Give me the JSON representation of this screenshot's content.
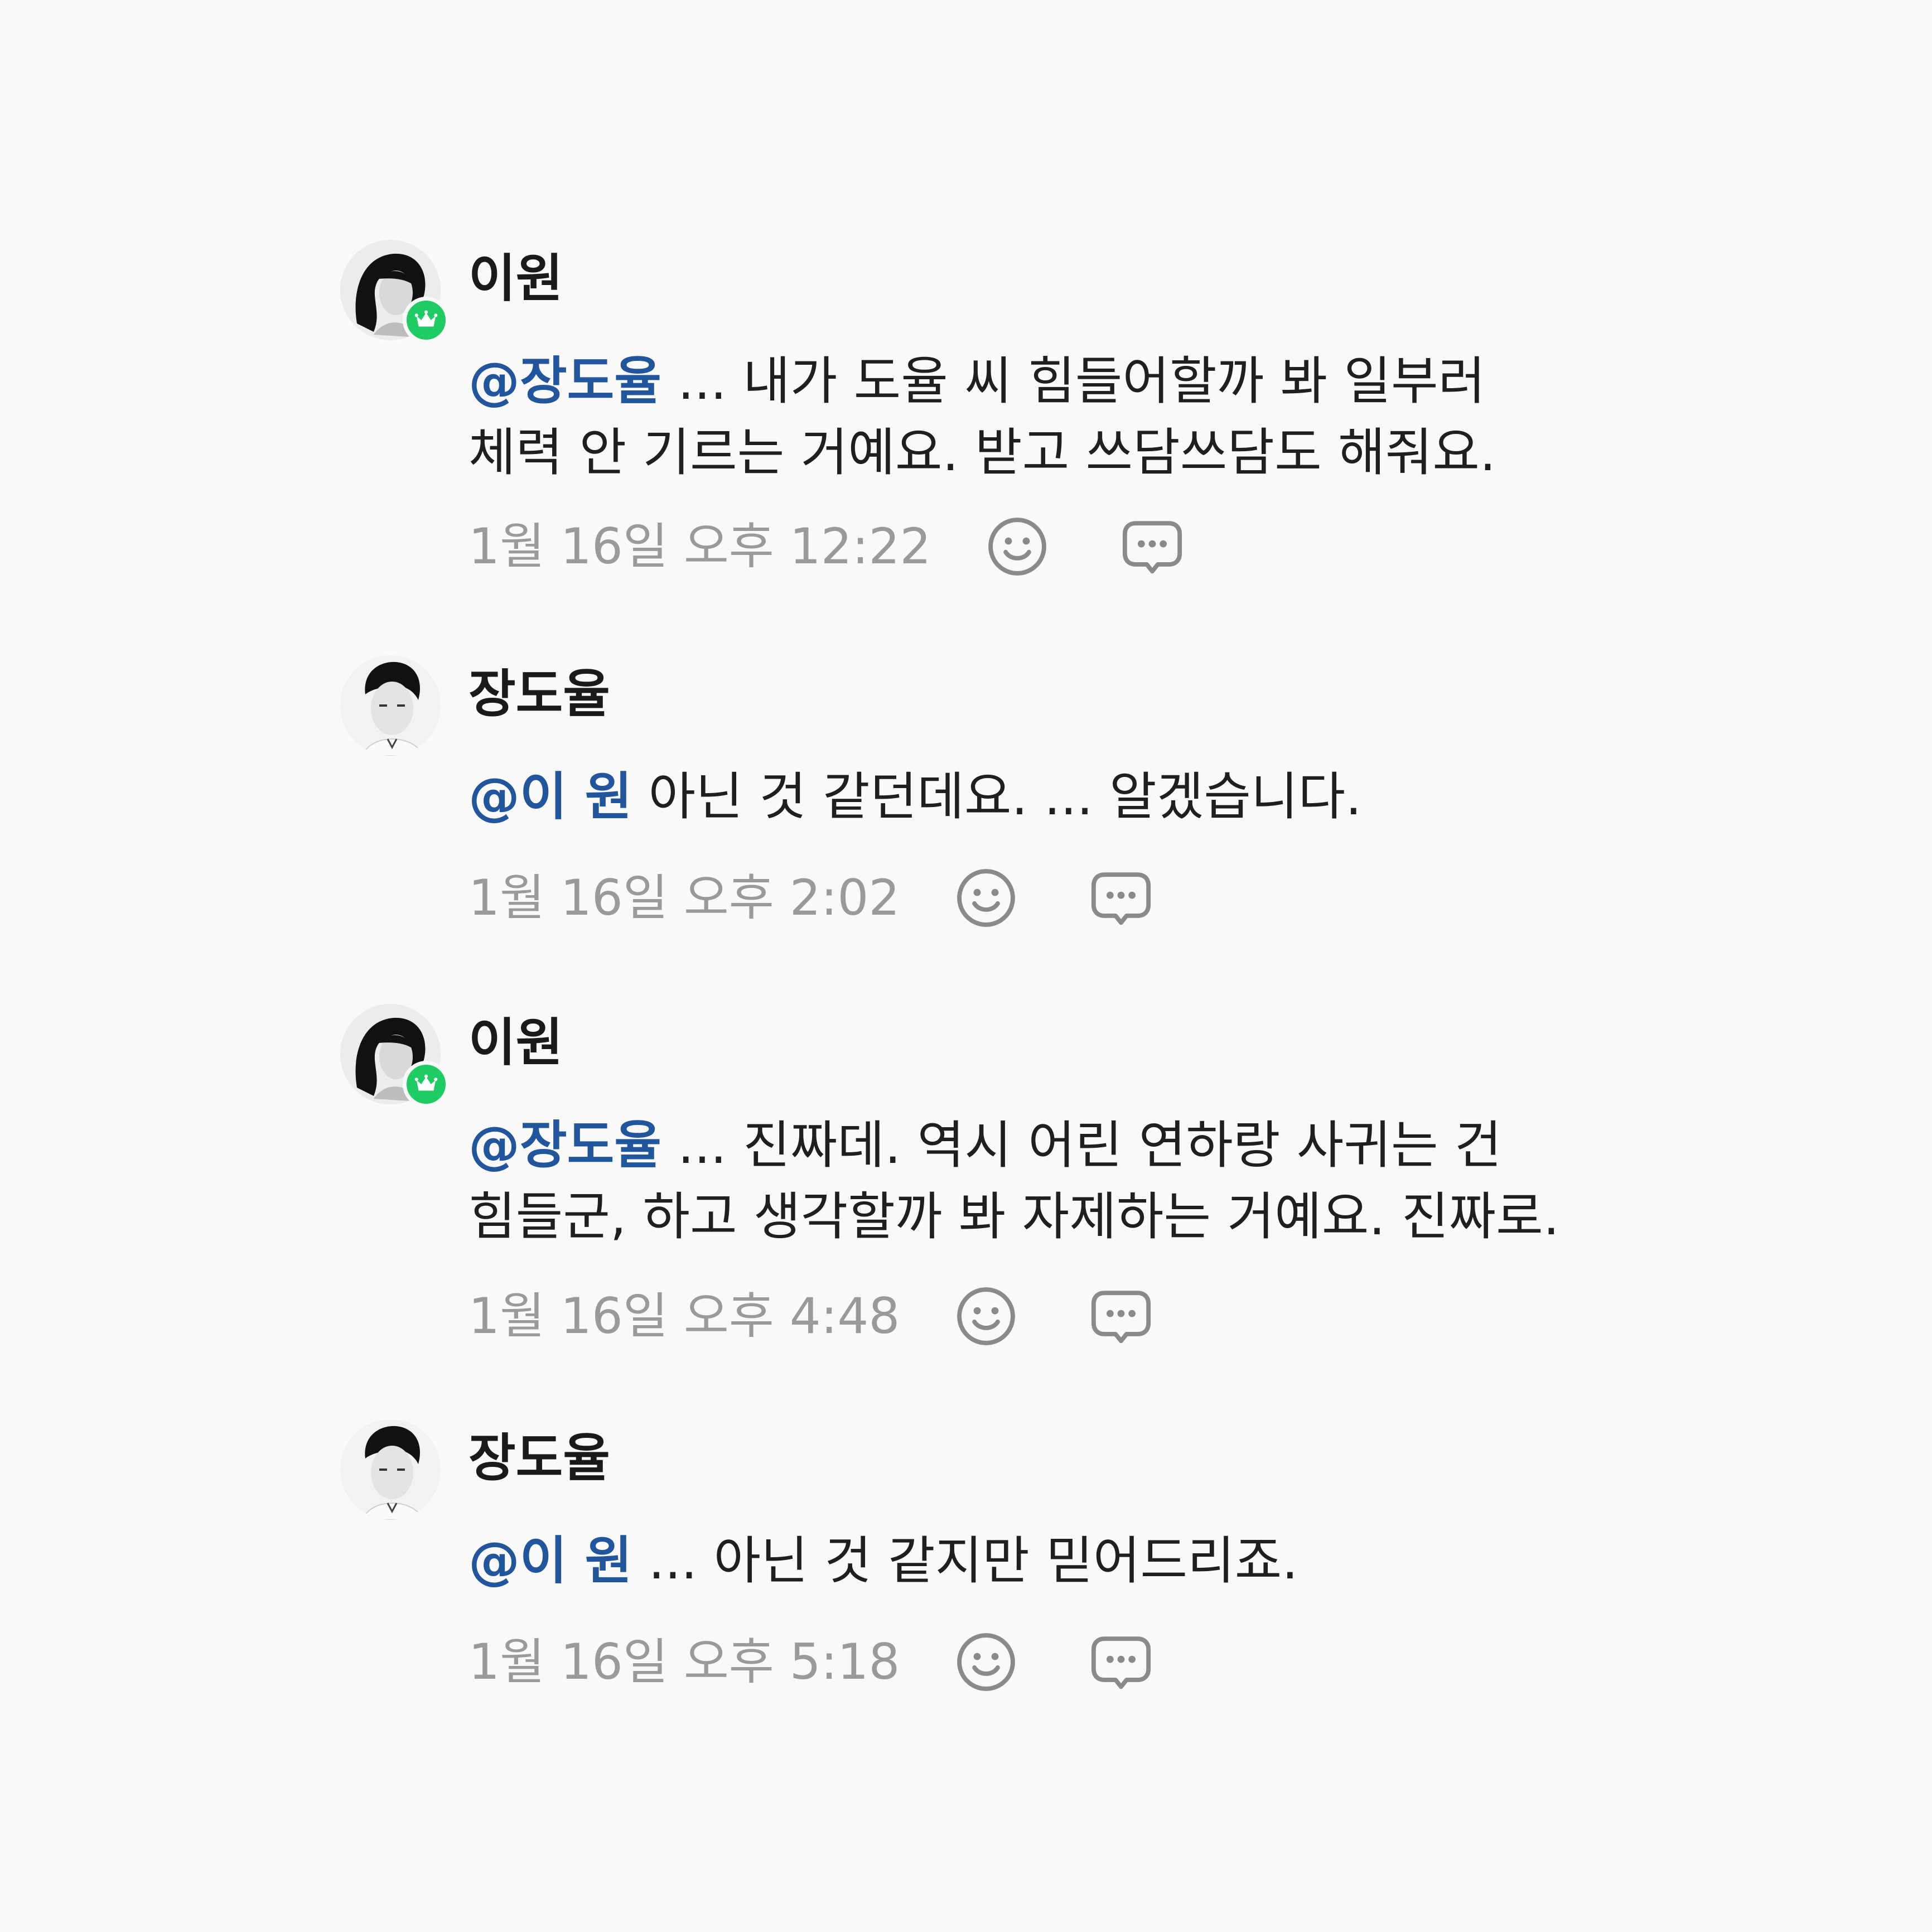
{
  "comments": [
    {
      "author": "이원",
      "mention": "@장도율",
      "text": " ... 내가 도율 씨 힘들어할까 봐 일부러 체력 안 기르는 거예요. 받고 쓰담쓰담도 해줘요.",
      "timestamp": "1월 16일 오후 12:22",
      "badge": "crown-icon"
    },
    {
      "author": "장도율",
      "mention": "@이 원",
      "text": " 아닌 것 같던데요. ... 알겠습니다.",
      "timestamp": "1월 16일 오후 2:02"
    },
    {
      "author": "이원",
      "mention": "@장도율",
      "text": " ... 진짜데. 역시 어린 연하랑 사귀는 건 힘들군, 하고 생각할까 봐 자제하는 거예요. 진짜로.",
      "timestamp": "1월 16일 오후 4:48",
      "badge": "crown-icon"
    },
    {
      "author": "장도율",
      "mention": "@이 원",
      "text": " ... 아닌 것 같지만 믿어드리죠.",
      "timestamp": "1월 16일 오후 5:18"
    }
  ],
  "icons": {
    "react": "smiley-icon",
    "reply": "speech-bubble-icon",
    "badge": "crown-icon"
  },
  "colors": {
    "background": "#f9f9f9",
    "mention": "#21569d",
    "timestamp": "#9a9a9a",
    "badge": "#1fcc63",
    "icon": "#8a8a8a"
  }
}
